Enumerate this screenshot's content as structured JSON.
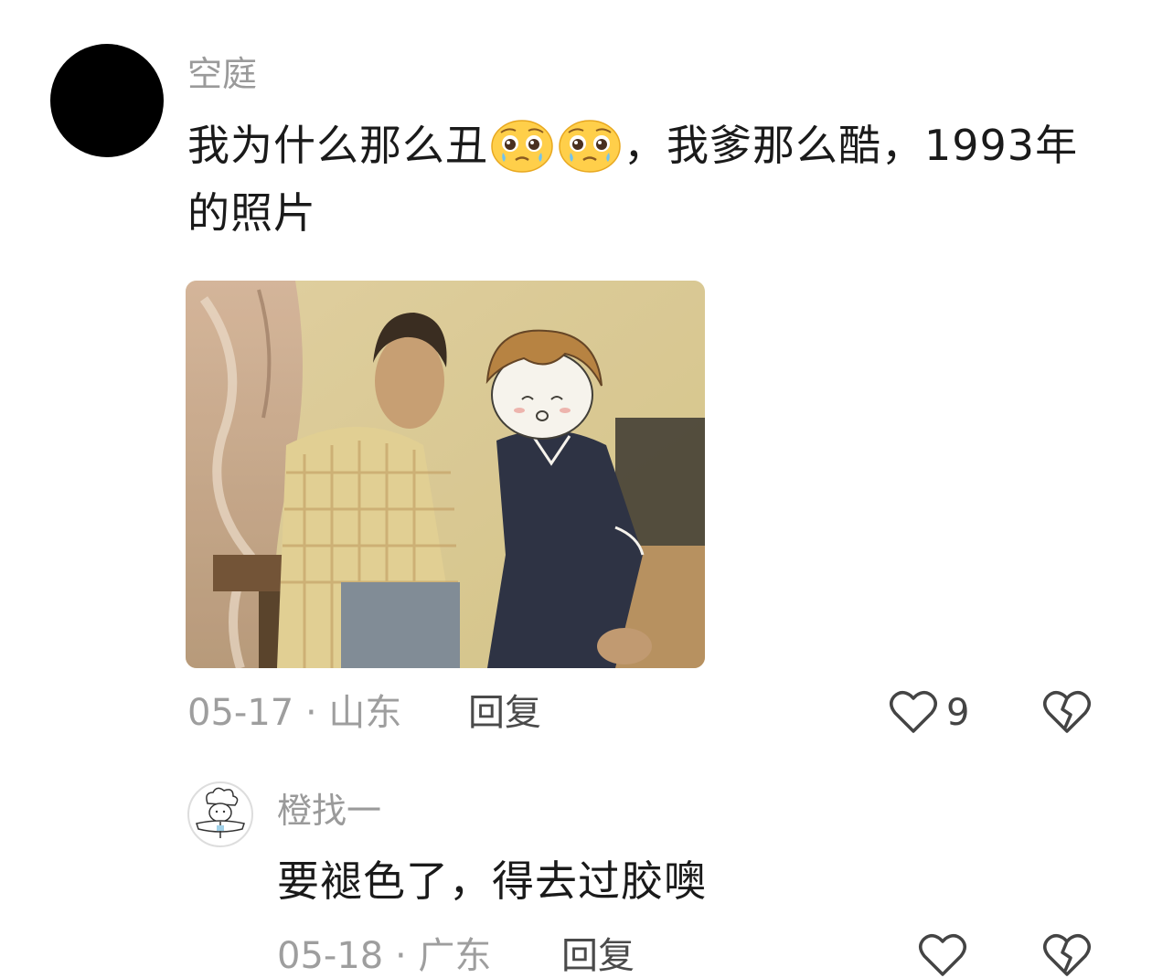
{
  "comment_main": {
    "username": "空庭",
    "text_part1": "我为什么那么丑",
    "text_part2": "，我爹那么酷，1993年的照片",
    "emoji_icon": "pleading-face-emoji",
    "date": "05-17 · 山东",
    "reply_label": "回复",
    "like_count": "9"
  },
  "comment_reply": {
    "username": "橙找一",
    "text": "要褪色了，得去过胶噢",
    "date": "05-18 · 广东",
    "reply_label": "回复",
    "avatar_icon": "chef-doodle-avatar"
  },
  "colors": {
    "name_gray": "#9a9a9a",
    "meta_gray": "#9e9e9e",
    "text": "#1a1a1a"
  }
}
